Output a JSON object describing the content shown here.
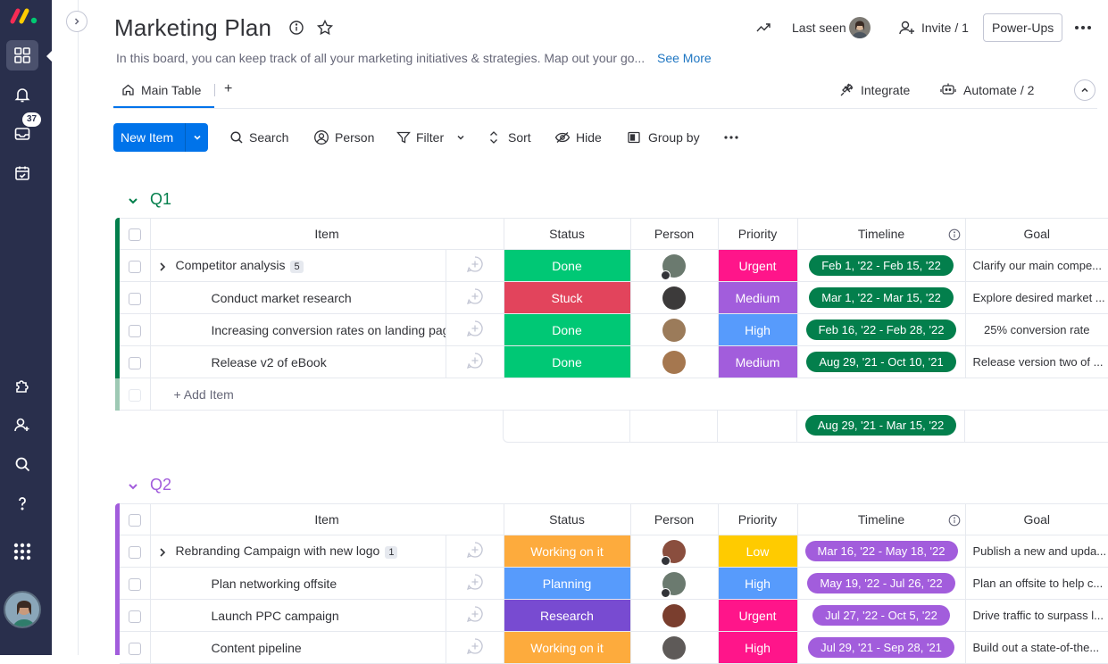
{
  "rail": {
    "badge_count": "37"
  },
  "header": {
    "title": "Marketing Plan",
    "description": "In this board, you can keep track of all your marketing initiatives & strategies. Map out your go...",
    "see_more": "See More",
    "last_seen": "Last seen",
    "invite": "Invite / 1",
    "power_ups": "Power-Ups"
  },
  "tabs": {
    "main_table": "Main Table",
    "add_tab": "+",
    "integrate": "Integrate",
    "automate": "Automate / 2"
  },
  "toolbar": {
    "new_item": "New Item",
    "search": "Search",
    "person": "Person",
    "filter": "Filter",
    "sort": "Sort",
    "hide": "Hide",
    "group_by": "Group by"
  },
  "columns": {
    "item": "Item",
    "status": "Status",
    "person": "Person",
    "priority": "Priority",
    "timeline": "Timeline",
    "goal": "Goal"
  },
  "colors": {
    "q1_group": "#037f4c",
    "q2_group": "#a25ddc",
    "done": "#00c875",
    "stuck": "#e2445c",
    "working": "#fdab3d",
    "planning": "#579bfc",
    "research": "#784bd1",
    "urgent": "#ff158a",
    "medium": "#a25ddc",
    "high": "#579bfc",
    "low": "#ffcb00",
    "q1_timeline": "#037f4c",
    "q2_timeline": "#a25ddc",
    "accent": "#0073ea"
  },
  "groups": [
    {
      "title": "Q1",
      "rows": [
        {
          "name": "Competitor analysis",
          "sub_count": "5",
          "status": "Done",
          "priority": "Urgent",
          "timeline": "Feb 1, '22 - Feb 15, '22",
          "goal": "Clarify our main compe..."
        },
        {
          "name": "Conduct market research",
          "sub_count": "",
          "status": "Stuck",
          "priority": "Medium",
          "timeline": "Mar 1, '22 - Mar 15, '22",
          "goal": "Explore desired market ..."
        },
        {
          "name": "Increasing conversion rates on landing pages",
          "sub_count": "",
          "status": "Done",
          "priority": "High",
          "timeline": "Feb 16, '22 - Feb 28, '22",
          "goal": "25% conversion rate"
        },
        {
          "name": "Release v2 of eBook",
          "sub_count": "",
          "status": "Done",
          "priority": "Medium",
          "timeline": "Aug 29, '21 - Oct 10, '21",
          "goal": "Release version two of ..."
        }
      ],
      "add_item": "+ Add Item",
      "summary_timeline": "Aug 29, '21 - Mar 15, '22"
    },
    {
      "title": "Q2",
      "rows": [
        {
          "name": "Rebranding Campaign with new logo",
          "sub_count": "1",
          "status": "Working on it",
          "priority": "Low",
          "timeline": "Mar 16, '22 - May 18, '22",
          "goal": "Publish a new and upda..."
        },
        {
          "name": "Plan networking offsite",
          "sub_count": "",
          "status": "Planning",
          "priority": "High",
          "timeline": "May 19, '22 - Jul 26, '22",
          "goal": "Plan an offsite to help c..."
        },
        {
          "name": "Launch PPC campaign",
          "sub_count": "",
          "status": "Research",
          "priority": "Urgent",
          "timeline": "Jul 27, '22 - Oct 5, '22",
          "goal": "Drive traffic to surpass l..."
        },
        {
          "name": "Content pipeline",
          "sub_count": "",
          "status": "Working on it",
          "priority": "High",
          "timeline": "Jul 29, '21 - Sep 28, '21",
          "goal": "Build out a state-of-the..."
        }
      ]
    }
  ]
}
